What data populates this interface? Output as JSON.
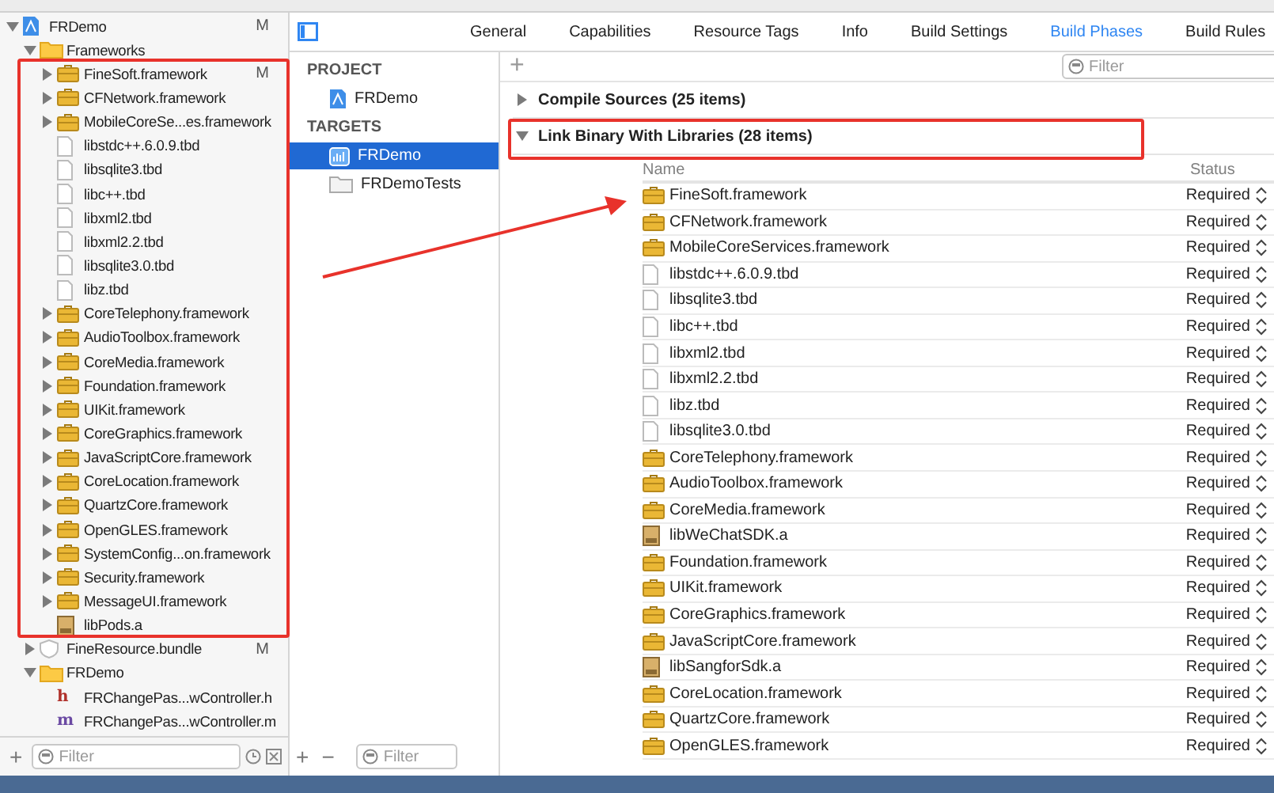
{
  "navigator": {
    "tree": [
      {
        "name": "FRDemo",
        "kind": "project",
        "expanded": true,
        "badge": "M",
        "children": [
          {
            "name": "Frameworks",
            "kind": "folder",
            "expanded": true,
            "children": [
              {
                "name": "FineSoft.framework",
                "kind": "framework",
                "expanded": false,
                "badge": "M"
              },
              {
                "name": "CFNetwork.framework",
                "kind": "framework",
                "expanded": false
              },
              {
                "name": "MobileCoreSe...es.framework",
                "kind": "framework",
                "expanded": false
              },
              {
                "name": "libstdc++.6.0.9.tbd",
                "kind": "tbd"
              },
              {
                "name": "libsqlite3.tbd",
                "kind": "tbd"
              },
              {
                "name": "libc++.tbd",
                "kind": "tbd"
              },
              {
                "name": "libxml2.tbd",
                "kind": "tbd"
              },
              {
                "name": "libxml2.2.tbd",
                "kind": "tbd"
              },
              {
                "name": "libsqlite3.0.tbd",
                "kind": "tbd"
              },
              {
                "name": "libz.tbd",
                "kind": "tbd"
              },
              {
                "name": "CoreTelephony.framework",
                "kind": "framework",
                "expanded": false
              },
              {
                "name": "AudioToolbox.framework",
                "kind": "framework",
                "expanded": false
              },
              {
                "name": "CoreMedia.framework",
                "kind": "framework",
                "expanded": false
              },
              {
                "name": "Foundation.framework",
                "kind": "framework",
                "expanded": false
              },
              {
                "name": "UIKit.framework",
                "kind": "framework",
                "expanded": false
              },
              {
                "name": "CoreGraphics.framework",
                "kind": "framework",
                "expanded": false
              },
              {
                "name": "JavaScriptCore.framework",
                "kind": "framework",
                "expanded": false
              },
              {
                "name": "CoreLocation.framework",
                "kind": "framework",
                "expanded": false
              },
              {
                "name": "QuartzCore.framework",
                "kind": "framework",
                "expanded": false
              },
              {
                "name": "OpenGLES.framework",
                "kind": "framework",
                "expanded": false
              },
              {
                "name": "SystemConfig...on.framework",
                "kind": "framework",
                "expanded": false
              },
              {
                "name": "Security.framework",
                "kind": "framework",
                "expanded": false
              },
              {
                "name": "MessageUI.framework",
                "kind": "framework",
                "expanded": false
              },
              {
                "name": "libPods.a",
                "kind": "archive"
              }
            ]
          },
          {
            "name": "FineResource.bundle",
            "kind": "bundle",
            "expanded": false,
            "badge": "M"
          },
          {
            "name": "FRDemo",
            "kind": "folder",
            "expanded": true,
            "children": [
              {
                "name": "FRChangePas...wController.h",
                "kind": "code",
                "icon_letter": "h",
                "color": "#b0312b"
              },
              {
                "name": "FRChangePas...wController.m",
                "kind": "code",
                "icon_letter": "m",
                "color": "#6b4aa3"
              }
            ]
          }
        ]
      }
    ],
    "add": "+",
    "filter_placeholder": "Filter"
  },
  "tabs": [
    {
      "label": "General",
      "selected": false
    },
    {
      "label": "Capabilities",
      "selected": false
    },
    {
      "label": "Resource Tags",
      "selected": false
    },
    {
      "label": "Info",
      "selected": false
    },
    {
      "label": "Build Settings",
      "selected": false
    },
    {
      "label": "Build Phases",
      "selected": true
    },
    {
      "label": "Build Rules",
      "selected": false
    }
  ],
  "targets_pane": {
    "sections": [
      {
        "heading": "PROJECT",
        "items": [
          {
            "name": "FRDemo",
            "kind": "project",
            "selected": false
          }
        ]
      },
      {
        "heading": "TARGETS",
        "items": [
          {
            "name": "FRDemo",
            "kind": "app",
            "selected": true
          },
          {
            "name": "FRDemoTests",
            "kind": "tests",
            "selected": false
          }
        ]
      }
    ],
    "add": "+",
    "remove": "−",
    "filter_placeholder": "Filter"
  },
  "editor": {
    "add": "+",
    "filter_placeholder": "Filter",
    "phases": [
      {
        "title": "Compile Sources (25 items)",
        "expanded": false
      },
      {
        "title": "Link Binary With Libraries (28 items)",
        "expanded": true,
        "columns": [
          "Name",
          "Status"
        ],
        "rows": [
          {
            "name": "FineSoft.framework",
            "kind": "framework",
            "status": "Required"
          },
          {
            "name": "CFNetwork.framework",
            "kind": "framework",
            "status": "Required"
          },
          {
            "name": "MobileCoreServices.framework",
            "kind": "framework",
            "status": "Required"
          },
          {
            "name": "libstdc++.6.0.9.tbd",
            "kind": "tbd",
            "status": "Required"
          },
          {
            "name": "libsqlite3.tbd",
            "kind": "tbd",
            "status": "Required"
          },
          {
            "name": "libc++.tbd",
            "kind": "tbd",
            "status": "Required"
          },
          {
            "name": "libxml2.tbd",
            "kind": "tbd",
            "status": "Required"
          },
          {
            "name": "libxml2.2.tbd",
            "kind": "tbd",
            "status": "Required"
          },
          {
            "name": "libz.tbd",
            "kind": "tbd",
            "status": "Required"
          },
          {
            "name": "libsqlite3.0.tbd",
            "kind": "tbd",
            "status": "Required"
          },
          {
            "name": "CoreTelephony.framework",
            "kind": "framework",
            "status": "Required"
          },
          {
            "name": "AudioToolbox.framework",
            "kind": "framework",
            "status": "Required"
          },
          {
            "name": "CoreMedia.framework",
            "kind": "framework",
            "status": "Required"
          },
          {
            "name": "libWeChatSDK.a",
            "kind": "archive",
            "status": "Required"
          },
          {
            "name": "Foundation.framework",
            "kind": "framework",
            "status": "Required"
          },
          {
            "name": "UIKit.framework",
            "kind": "framework",
            "status": "Required"
          },
          {
            "name": "CoreGraphics.framework",
            "kind": "framework",
            "status": "Required"
          },
          {
            "name": "JavaScriptCore.framework",
            "kind": "framework",
            "status": "Required"
          },
          {
            "name": "libSangforSdk.a",
            "kind": "archive",
            "status": "Required"
          },
          {
            "name": "CoreLocation.framework",
            "kind": "framework",
            "status": "Required"
          },
          {
            "name": "QuartzCore.framework",
            "kind": "framework",
            "status": "Required"
          },
          {
            "name": "OpenGLES.framework",
            "kind": "framework",
            "status": "Required"
          }
        ]
      }
    ]
  }
}
